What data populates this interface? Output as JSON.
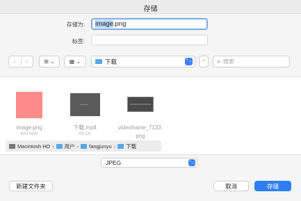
{
  "window": {
    "title": "存储"
  },
  "form": {
    "save_as_label": "存储为:",
    "filename_selected": "image",
    "filename_rest": ".png",
    "tags_label": "标签:"
  },
  "toolbar": {
    "back_glyph": "‹",
    "forward_glyph": "›",
    "view_icon_glyph": "⊞ ⌄",
    "group_icon_glyph": "▦ ⌄",
    "location": "下载",
    "location_stepper_glyph": "⌃⌄",
    "up_glyph": "⌃",
    "search_glyph": "⌕",
    "search_placeholder": "搜索"
  },
  "files": [
    {
      "name": "image.png",
      "meta": "400×400",
      "kind": "image"
    },
    {
      "name": "下载.mp4",
      "meta": "00:16",
      "kind": "video"
    },
    {
      "name": "videoframe_7133.",
      "meta": "png",
      "kind": "frame"
    }
  ],
  "path": {
    "chevron": "›",
    "items": [
      "Macintosh HD",
      "用户",
      "fangjunyu",
      "下载"
    ]
  },
  "format": {
    "value": "JPEG",
    "stepper_glyph": "⌃⌄"
  },
  "buttons": {
    "new_folder": "新建文件夹",
    "cancel": "取消",
    "save": "存储"
  },
  "colors": {
    "accent": "#2f7df4",
    "folder": "#5aa8e8",
    "image_thumb": "#ff8c8a"
  }
}
